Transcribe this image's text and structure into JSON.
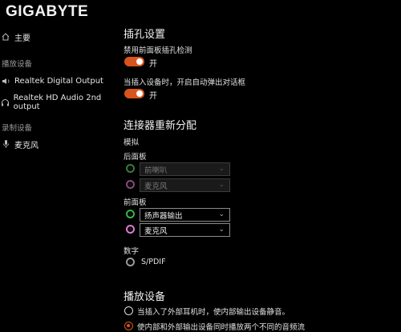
{
  "brand": "GIGABYTE",
  "sidebar": {
    "home": "主要",
    "playback_section": "播放设备",
    "playback_items": [
      "Realtek Digital Output",
      "Realtek HD Audio 2nd output"
    ],
    "recording_section": "录制设备",
    "recording_items": [
      "麦克风"
    ]
  },
  "jack_settings": {
    "title": "插孔设置",
    "disable_front_label": "禁用前面板插孔检测",
    "disable_front_state": "开",
    "popup_label": "当插入设备时，开启自动弹出对话框",
    "popup_state": "开"
  },
  "connector": {
    "title": "连接器重新分配",
    "analog_label": "模拟",
    "rear_label": "后面板",
    "rear_jacks": [
      {
        "value": "前喇叭",
        "color": "#3a7a3a",
        "disabled": true
      },
      {
        "value": "麦克风",
        "color": "#8a4a78",
        "disabled": true
      }
    ],
    "front_label": "前面板",
    "front_jacks": [
      {
        "value": "扬声器输出",
        "color": "#36b44a",
        "disabled": false
      },
      {
        "value": "麦克风",
        "color": "#e07ad0",
        "disabled": false
      }
    ],
    "digital_label": "数字",
    "spdif_label": "S/PDIF"
  },
  "playback": {
    "title": "播放设备",
    "option1": "当插入了外部耳机时，使内部输出设备静音。",
    "option2": "使内部和外部输出设备同时播放两个不同的音频流"
  },
  "colors": {
    "accent": "#d9541d"
  }
}
